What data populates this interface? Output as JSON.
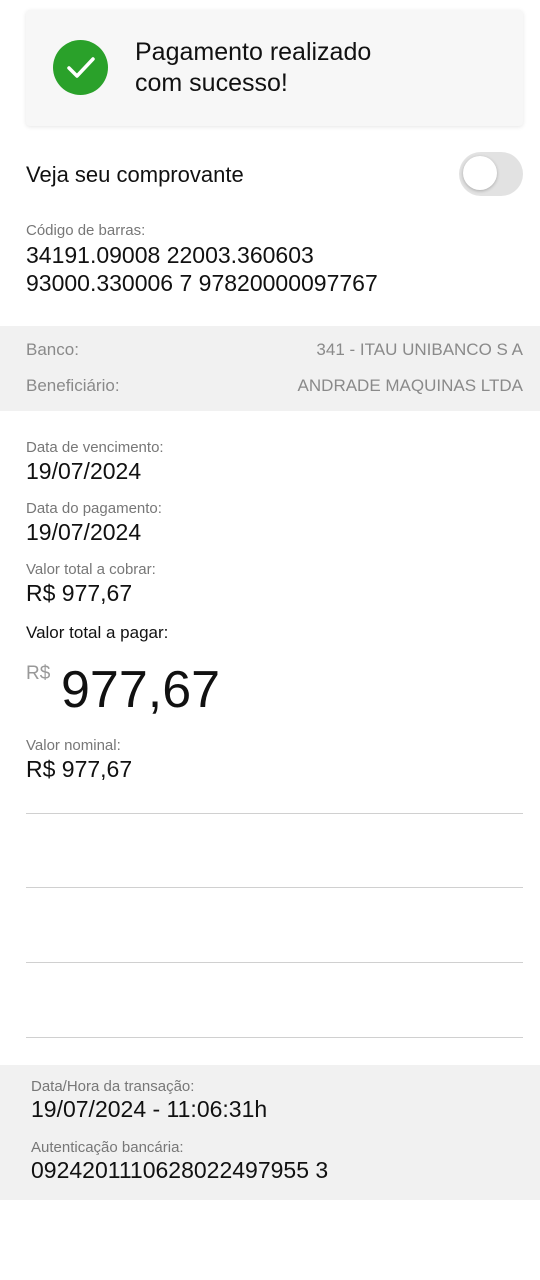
{
  "success": {
    "message_line1": "Pagamento realizado",
    "message_line2": "com sucesso!",
    "icon": "check-icon",
    "color": "#2aa12a"
  },
  "receipt": {
    "label": "Veja seu comprovante",
    "toggle_on": false
  },
  "barcode": {
    "label": "Código de barras:",
    "line1": "34191.09008 22003.360603",
    "line2": "93000.330006 7 97820000097767"
  },
  "bank": {
    "bank_label": "Banco:",
    "bank_value": "341 - ITAU UNIBANCO S A",
    "beneficiary_label": "Beneficiário:",
    "beneficiary_value": "ANDRADE MAQUINAS LTDA"
  },
  "details": {
    "due_date_label": "Data de vencimento:",
    "due_date_value": "19/07/2024",
    "payment_date_label": "Data do pagamento:",
    "payment_date_value": "19/07/2024",
    "total_charge_label": "Valor total a cobrar:",
    "total_charge_value": "R$  977,67",
    "total_pay_label": "Valor total a pagar:",
    "total_pay_currency": "R$",
    "total_pay_amount": "977,67",
    "nominal_label": "Valor nominal:",
    "nominal_value": "R$  977,67"
  },
  "footer": {
    "transaction_label": "Data/Hora da transação:",
    "transaction_value": "19/07/2024 - 11:06:31h",
    "auth_label": "Autenticação bancária:",
    "auth_value": "0924201110628022497955 3"
  }
}
